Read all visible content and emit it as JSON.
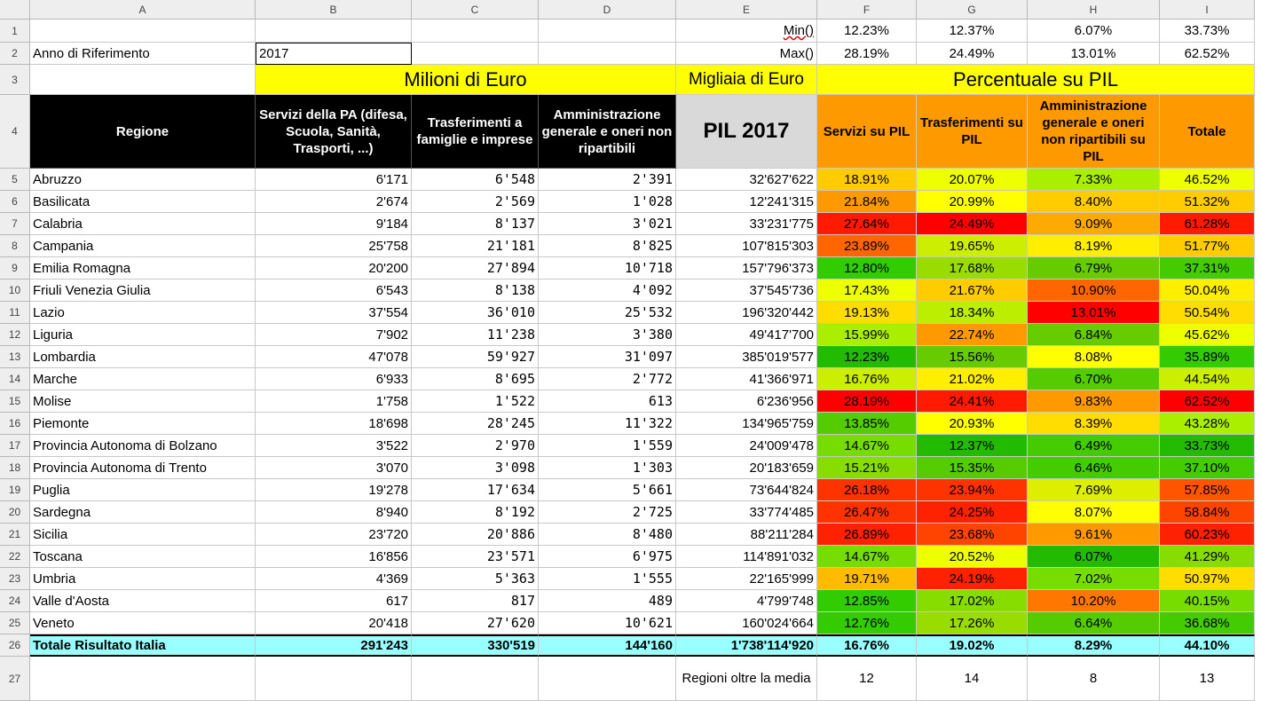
{
  "columns": [
    "A",
    "B",
    "C",
    "D",
    "E",
    "F",
    "G",
    "H",
    "I"
  ],
  "row_numbers": [
    "1",
    "2",
    "3",
    "4",
    "5",
    "6",
    "7",
    "8",
    "9",
    "10",
    "11",
    "12",
    "13",
    "14",
    "15",
    "16",
    "17",
    "18",
    "19",
    "20",
    "21",
    "22",
    "23",
    "24",
    "25",
    "26",
    "27"
  ],
  "min_max": {
    "min_label": "Min()",
    "max_label": "Max()",
    "min": [
      "12.23%",
      "12.37%",
      "6.07%",
      "33.73%"
    ],
    "max": [
      "28.19%",
      "24.49%",
      "13.01%",
      "62.52%"
    ]
  },
  "anno": {
    "label": "Anno di Riferimento",
    "value": "2017"
  },
  "groups": {
    "milioni": "Milioni di Euro",
    "migliaia": "Migliaia di Euro",
    "percentuale": "Percentuale su PIL"
  },
  "headers": {
    "regione": "Regione",
    "servizi": "Servizi della PA (difesa, Scuola, Sanità, Trasporti, ...)",
    "trasferimenti": "Trasferimenti a famiglie e imprese",
    "amministrazione": "Amministrazione generale e oneri non ripartibili",
    "pil": "PIL 2017",
    "servizi_pil": "Servizi su PIL",
    "trasferimenti_pil": "Trasferimenti su PIL",
    "amministrazione_pil": "Amministrazione generale e oneri non ripartibili su PIL",
    "totale": "Totale"
  },
  "colors": {
    "yellow": "#ffff00",
    "orange_header": "#ff9900",
    "total_row": "#99ffff",
    "scale_low": "#00cc00",
    "scale_mid": "#ffff00",
    "scale_high": "#ff0000"
  },
  "rows": [
    {
      "name": "Abruzzo",
      "b": "6'171",
      "c": "6'548",
      "d": "2'391",
      "e": "32'627'622",
      "f": "18.91%",
      "g": "20.07%",
      "h": "7.33%",
      "i": "46.52%",
      "cf": "#ffcc00",
      "cg": "#eeff00",
      "ch": "#aaee00",
      "ci": "#eeff00"
    },
    {
      "name": "Basilicata",
      "b": "2'674",
      "c": "2'569",
      "d": "1'028",
      "e": "12'241'315",
      "f": "21.84%",
      "g": "20.99%",
      "h": "8.40%",
      "i": "51.32%",
      "cf": "#ff9900",
      "cg": "#ffff00",
      "ch": "#ffcc00",
      "ci": "#ffcc00"
    },
    {
      "name": "Calabria",
      "b": "9'184",
      "c": "8'137",
      "d": "3'021",
      "e": "33'231'775",
      "f": "27.64%",
      "g": "24.49%",
      "h": "9.09%",
      "i": "61.28%",
      "cf": "#ff1a00",
      "cg": "#ff0000",
      "ch": "#ffaa00",
      "ci": "#ff1a00"
    },
    {
      "name": "Campania",
      "b": "25'758",
      "c": "21'181",
      "d": "8'825",
      "e": "107'815'303",
      "f": "23.89%",
      "g": "19.65%",
      "h": "8.19%",
      "i": "51.77%",
      "cf": "#ff6600",
      "cg": "#ccee00",
      "ch": "#ffee00",
      "ci": "#ffcc00"
    },
    {
      "name": "Emilia Romagna",
      "b": "20'200",
      "c": "27'894",
      "d": "10'718",
      "e": "157'796'373",
      "f": "12.80%",
      "g": "17.68%",
      "h": "6.79%",
      "i": "37.31%",
      "cf": "#33cc00",
      "cg": "#99dd00",
      "ch": "#66cc00",
      "ci": "#44cc00"
    },
    {
      "name": "Friuli Venezia Giulia",
      "b": "6'543",
      "c": "8'138",
      "d": "4'092",
      "e": "37'545'736",
      "f": "17.43%",
      "g": "21.67%",
      "h": "10.90%",
      "i": "50.04%",
      "cf": "#eeff00",
      "cg": "#ffcc00",
      "ch": "#ff6600",
      "ci": "#ffee00"
    },
    {
      "name": "Lazio",
      "b": "37'554",
      "c": "36'010",
      "d": "25'532",
      "e": "196'320'442",
      "f": "19.13%",
      "g": "18.34%",
      "h": "13.01%",
      "i": "50.54%",
      "cf": "#ffdd00",
      "cg": "#bbee00",
      "ch": "#ff0000",
      "ci": "#ffdd00"
    },
    {
      "name": "Liguria",
      "b": "7'902",
      "c": "11'238",
      "d": "3'380",
      "e": "49'417'700",
      "f": "15.99%",
      "g": "22.74%",
      "h": "6.84%",
      "i": "45.62%",
      "cf": "#aaee00",
      "cg": "#ff9900",
      "ch": "#66cc00",
      "ci": "#eeff00"
    },
    {
      "name": "Lombardia",
      "b": "47'078",
      "c": "59'927",
      "d": "31'097",
      "e": "385'019'577",
      "f": "12.23%",
      "g": "15.56%",
      "h": "8.08%",
      "i": "35.89%",
      "cf": "#22bb00",
      "cg": "#66cc00",
      "ch": "#ffff00",
      "ci": "#33cc00"
    },
    {
      "name": "Marche",
      "b": "6'933",
      "c": "8'695",
      "d": "2'772",
      "e": "41'366'971",
      "f": "16.76%",
      "g": "21.02%",
      "h": "6.70%",
      "i": "44.54%",
      "cf": "#ccee00",
      "cg": "#ffee00",
      "ch": "#55cc00",
      "ci": "#ccee00"
    },
    {
      "name": "Molise",
      "b": "1'758",
      "c": "1'522",
      "d": "613",
      "e": "6'236'956",
      "f": "28.19%",
      "g": "24.41%",
      "h": "9.83%",
      "i": "62.52%",
      "cf": "#ff0000",
      "cg": "#ff1a00",
      "ch": "#ff9900",
      "ci": "#ff0000"
    },
    {
      "name": "Piemonte",
      "b": "18'698",
      "c": "28'245",
      "d": "11'322",
      "e": "134'965'759",
      "f": "13.85%",
      "g": "20.93%",
      "h": "8.39%",
      "i": "43.28%",
      "cf": "#55cc00",
      "cg": "#ffff00",
      "ch": "#ffdd00",
      "ci": "#aaee00"
    },
    {
      "name": "Provincia Autonoma di Bolzano",
      "b": "3'522",
      "c": "2'970",
      "d": "1'559",
      "e": "24'009'478",
      "f": "14.67%",
      "g": "12.37%",
      "h": "6.49%",
      "i": "33.73%",
      "cf": "#77dd00",
      "cg": "#22bb00",
      "ch": "#44cc00",
      "ci": "#22bb00"
    },
    {
      "name": "Provincia Autonoma di Trento",
      "b": "3'070",
      "c": "3'098",
      "d": "1'303",
      "e": "20'183'659",
      "f": "15.21%",
      "g": "15.35%",
      "h": "6.46%",
      "i": "37.10%",
      "cf": "#88dd00",
      "cg": "#55cc00",
      "ch": "#44cc00",
      "ci": "#44cc00"
    },
    {
      "name": "Puglia",
      "b": "19'278",
      "c": "17'634",
      "d": "5'661",
      "e": "73'644'824",
      "f": "26.18%",
      "g": "23.94%",
      "h": "7.69%",
      "i": "57.85%",
      "cf": "#ff3300",
      "cg": "#ff3300",
      "ch": "#ddee00",
      "ci": "#ff5500"
    },
    {
      "name": "Sardegna",
      "b": "8'940",
      "c": "8'192",
      "d": "2'725",
      "e": "33'774'485",
      "f": "26.47%",
      "g": "24.25%",
      "h": "8.07%",
      "i": "58.84%",
      "cf": "#ff3300",
      "cg": "#ff2200",
      "ch": "#ffff00",
      "ci": "#ff4400"
    },
    {
      "name": "Sicilia",
      "b": "23'720",
      "c": "20'886",
      "d": "8'480",
      "e": "88'211'284",
      "f": "26.89%",
      "g": "23.68%",
      "h": "9.61%",
      "i": "60.23%",
      "cf": "#ff2200",
      "cg": "#ff4400",
      "ch": "#ff9900",
      "ci": "#ff2200"
    },
    {
      "name": "Toscana",
      "b": "16'856",
      "c": "23'571",
      "d": "6'975",
      "e": "114'891'032",
      "f": "14.67%",
      "g": "20.52%",
      "h": "6.07%",
      "i": "41.29%",
      "cf": "#77dd00",
      "cg": "#eeff00",
      "ch": "#22bb00",
      "ci": "#88dd00"
    },
    {
      "name": "Umbria",
      "b": "4'369",
      "c": "5'363",
      "d": "1'555",
      "e": "22'165'999",
      "f": "19.71%",
      "g": "24.19%",
      "h": "7.02%",
      "i": "50.97%",
      "cf": "#ffbb00",
      "cg": "#ff2200",
      "ch": "#77dd00",
      "ci": "#ffdd00"
    },
    {
      "name": "Valle d'Aosta",
      "b": "617",
      "c": "817",
      "d": "489",
      "e": "4'799'748",
      "f": "12.85%",
      "g": "17.02%",
      "h": "10.20%",
      "i": "40.15%",
      "cf": "#33cc00",
      "cg": "#88dd00",
      "ch": "#ff7700",
      "ci": "#77dd00"
    },
    {
      "name": "Veneto",
      "b": "20'418",
      "c": "27'620",
      "d": "10'621",
      "e": "160'024'664",
      "f": "12.76%",
      "g": "17.26%",
      "h": "6.64%",
      "i": "36.68%",
      "cf": "#33cc00",
      "cg": "#99dd00",
      "ch": "#55cc00",
      "ci": "#44cc00"
    }
  ],
  "total": {
    "name": "Totale Risultato Italia",
    "b": "291'243",
    "c": "330'519",
    "d": "144'160",
    "e": "1'738'114'920",
    "f": "16.76%",
    "g": "19.02%",
    "h": "8.29%",
    "i": "44.10%"
  },
  "oltre_media": {
    "label": "Regioni oltre la media",
    "f": "12",
    "g": "14",
    "h": "8",
    "i": "13"
  }
}
